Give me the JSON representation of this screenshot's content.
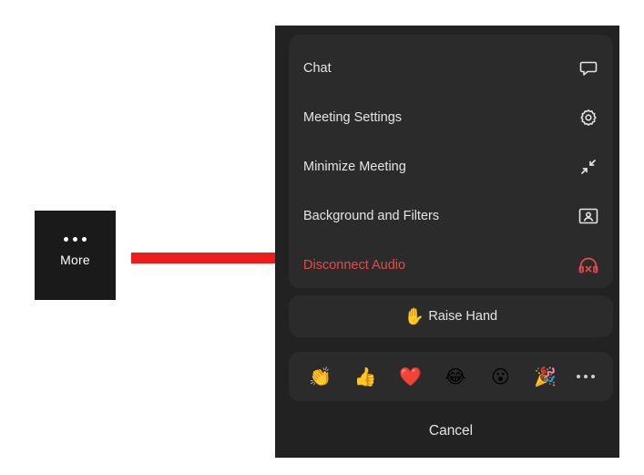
{
  "more_button": {
    "label": "More",
    "icon": "ellipsis-icon"
  },
  "menu": {
    "items": [
      {
        "label": "Chat",
        "icon": "chat-bubble-icon"
      },
      {
        "label": "Meeting Settings",
        "icon": "gear-icon"
      },
      {
        "label": "Minimize Meeting",
        "icon": "minimize-arrows-icon"
      },
      {
        "label": "Background and Filters",
        "icon": "background-portrait-icon"
      },
      {
        "label": "Disconnect Audio",
        "icon": "headphones-disconnect-icon",
        "color": "#e8484a"
      }
    ],
    "raise_hand": {
      "emoji": "✋",
      "label": "Raise Hand"
    },
    "reactions": [
      "👏",
      "👍",
      "❤️",
      "😂",
      "😮",
      "🎉"
    ],
    "reactions_more_icon": "ellipsis-icon",
    "cancel_label": "Cancel"
  },
  "colors": {
    "arrow": "#ee1c1c",
    "panel_bg": "#222222",
    "group_bg": "#2b2b2b",
    "danger": "#e8484a"
  }
}
